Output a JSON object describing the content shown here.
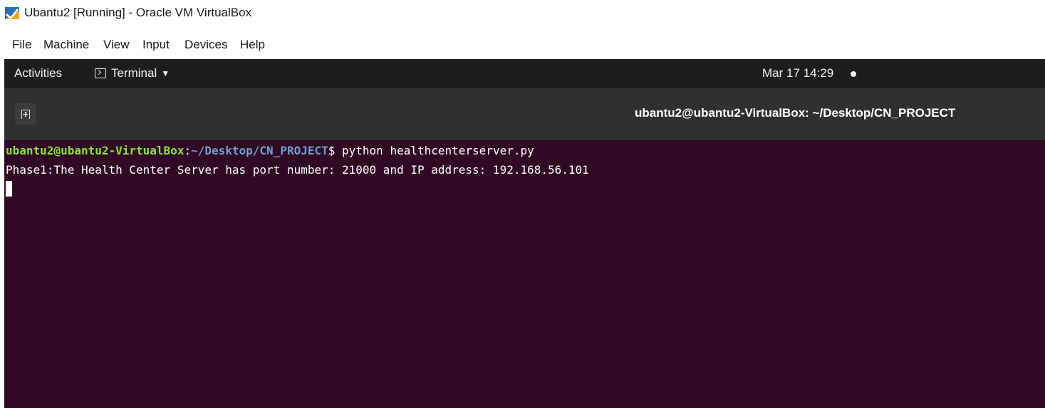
{
  "window": {
    "title": "Ubantu2 [Running] - Oracle VM VirtualBox",
    "icon": "virtualbox-icon"
  },
  "menubar": {
    "items": [
      "File",
      "Machine",
      "View",
      "Input",
      "Devices",
      "Help"
    ]
  },
  "topbar": {
    "activities": "Activities",
    "app_menu": "Terminal",
    "clock": "Mar 17  14:29"
  },
  "terminal": {
    "title": "ubantu2@ubantu2-VirtualBox: ~/Desktop/CN_PROJECT",
    "prompt_user": "ubantu2@ubantu2-VirtualBox",
    "prompt_sep": ":",
    "prompt_path": "~/Desktop/CN_PROJECT",
    "prompt_tail": "$ python healthcenterserver.py",
    "output_line": "Phase1:The Health Center Server has port number: 21000 and IP address: 192.168.56.101"
  },
  "colors": {
    "terminal_bg": "#300a24",
    "prompt_user": "#8ae234",
    "prompt_path": "#729fcf",
    "topbar_bg": "#1d1d1d",
    "header_bg": "#303030"
  }
}
